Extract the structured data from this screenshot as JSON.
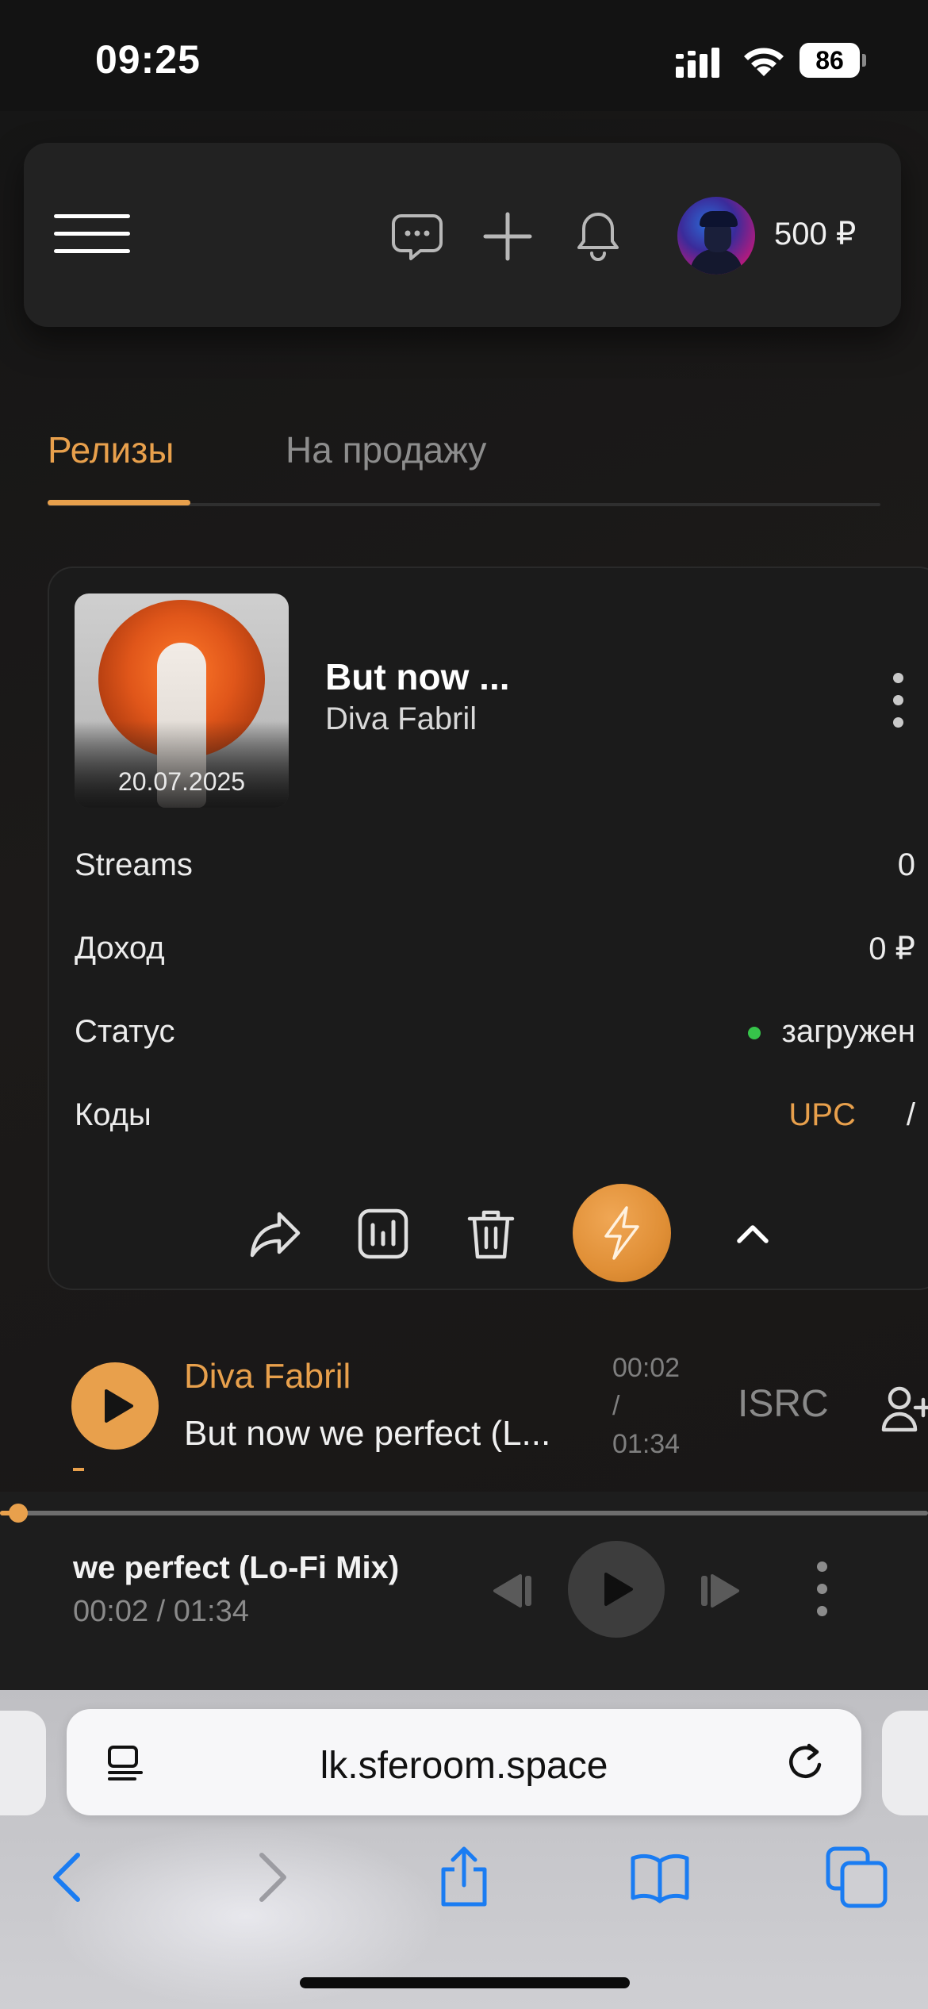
{
  "status_bar": {
    "time": "09:25",
    "battery": "86",
    "icons": [
      "cellular-signal-icon",
      "wifi-icon",
      "battery-icon"
    ]
  },
  "header": {
    "icons": [
      "menu-icon",
      "chat-icon",
      "plus-icon",
      "bell-icon"
    ],
    "balance": "500 ₽"
  },
  "tabs": [
    {
      "label": "Релизы",
      "active": true
    },
    {
      "label": "На продажу",
      "active": false
    }
  ],
  "release": {
    "cover_date": "20.07.2025",
    "title": "But now ...",
    "artist": "Diva Fabril",
    "rows": {
      "streams": {
        "label": "Streams",
        "value": "0"
      },
      "income": {
        "label": "Доход",
        "value": "0 ₽"
      },
      "status": {
        "label": "Статус",
        "value": "загружен"
      },
      "codes": {
        "label": "Коды",
        "upc": "UPC",
        "separator": "/"
      }
    },
    "actions": [
      "share-icon",
      "stats-icon",
      "trash-icon",
      "lightning-icon",
      "chevron-up-icon"
    ]
  },
  "track": {
    "artist": "Diva Fabril",
    "title": "But now we perfect (L...",
    "time_current": "00:02",
    "time_separator": "/",
    "time_total": "01:34",
    "isrc_label": "ISRC"
  },
  "player": {
    "title": "we perfect (Lo-Fi Mix)",
    "time": "00:02 / 01:34",
    "progress": 0.02
  },
  "browser": {
    "url": "lk.sferoom.space",
    "nav": [
      "back-icon",
      "forward-icon",
      "share-icon",
      "bookmarks-icon",
      "tabs-icon"
    ]
  },
  "colors": {
    "accent": "#e8a04c",
    "status_ok": "#36c44a",
    "background": "#131313",
    "safari_blue": "#1a7cf2"
  }
}
